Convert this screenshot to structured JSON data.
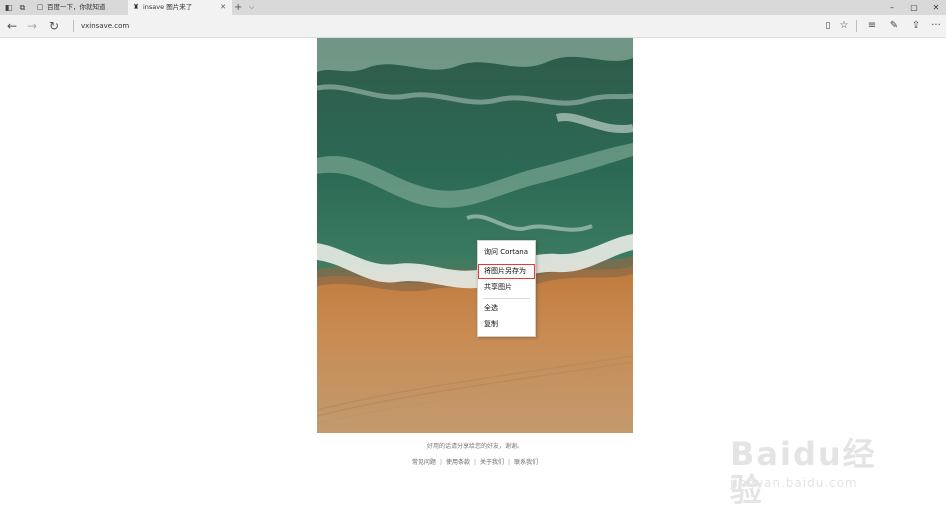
{
  "tabs": [
    {
      "label": "百度一下，你就知道",
      "fav": "baidu-icon"
    },
    {
      "label": "insave 图片来了",
      "fav": "insave-icon",
      "close": "✕"
    }
  ],
  "tabbar": {
    "new_tab": "+",
    "tabs_menu": "⌵"
  },
  "window": {
    "minimize": "–",
    "maximize": "▢",
    "close": "✕"
  },
  "nav": {
    "back": "←",
    "forward": "→",
    "refresh": "↻",
    "url": "vxinsave.com"
  },
  "toolbar": {
    "reading_view": "▯",
    "favorite": "☆",
    "hub": "≡",
    "notes": "✎",
    "share": "⇪",
    "more": "···"
  },
  "context_menu": {
    "items": [
      {
        "label": "询问 Cortana",
        "highlighted": false
      },
      {
        "label": "将图片另存为",
        "highlighted": true
      },
      {
        "label": "共享图片",
        "highlighted": false
      },
      {
        "label": "全选",
        "highlighted": false
      },
      {
        "label": "复制",
        "highlighted": false
      }
    ],
    "highlight_color": "#e53935"
  },
  "footer": {
    "text": "好用的话请分享给您的好友，谢谢。",
    "links": [
      "常见问题",
      "使用条款",
      "关于我们",
      "联系我们"
    ]
  },
  "watermark": {
    "main": "Baidu经验",
    "sub": "jingyan.baidu.com"
  }
}
